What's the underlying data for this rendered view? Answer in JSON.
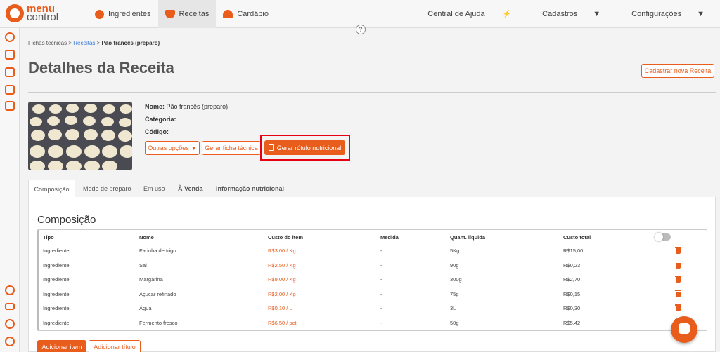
{
  "brand": {
    "line1": "menu",
    "line2": "control"
  },
  "nav": {
    "items": [
      {
        "label": "Ingredientes",
        "icon": "tomato-icon"
      },
      {
        "label": "Receitas",
        "icon": "bowl-icon"
      },
      {
        "label": "Cardápio",
        "icon": "cloche-icon"
      }
    ],
    "right": {
      "help": "Central de Ajuda",
      "cadastros": "Cadastros",
      "config": "Configurações"
    }
  },
  "help_badge": "?",
  "breadcrumb": {
    "a": "Fichas técnicas",
    "sep1": " > ",
    "b": "Receitas",
    "sep2": " > ",
    "c": "Pão francês (preparo)"
  },
  "page": {
    "title": "Detalhes da Receita",
    "new_button": "Cadastrar nova Receita"
  },
  "recipe": {
    "name_label": "Nome:",
    "name_value": "Pão francês (preparo)",
    "category_label": "Categoria:",
    "code_label": "Código:"
  },
  "actions": {
    "more": "Outras opções",
    "sheet": "Gerar ficha técnica",
    "label": "Gerar rótulo nutricional"
  },
  "tabs": [
    "Composição",
    "Modo de preparo",
    "Em uso",
    "À Venda",
    "Informação nutricional"
  ],
  "section_title": "Composição",
  "table": {
    "headers": [
      "Tipo",
      "Nome",
      "Custo do item",
      "Medida",
      "Quant. líquida",
      "Custo total"
    ],
    "rows": [
      [
        "Ingrediente",
        "Farinha de trigo",
        "R$3,00 / Kg",
        "-",
        "5Kg",
        "R$15,00"
      ],
      [
        "Ingrediente",
        "Sal",
        "R$2,50 / Kg",
        "-",
        "90g",
        "R$0,23"
      ],
      [
        "Ingrediente",
        "Margarina",
        "R$9,00 / Kg",
        "-",
        "300g",
        "R$2,70"
      ],
      [
        "Ingrediente",
        "Açucar refinado",
        "R$2,00 / Kg",
        "-",
        "75g",
        "R$0,15"
      ],
      [
        "Ingrediente",
        "Água",
        "R$0,10 / L",
        "-",
        "3L",
        "R$0,30"
      ],
      [
        "Ingrediente",
        "Fermento fresco",
        "R$6,50 / pct",
        "-",
        "50g",
        "R$5,42"
      ]
    ]
  },
  "footer_buttons": {
    "add_item": "Adicionar item",
    "add_title": "Adicionar título"
  },
  "colors": {
    "accent": "#e85c1c",
    "highlight": "#e60012"
  }
}
